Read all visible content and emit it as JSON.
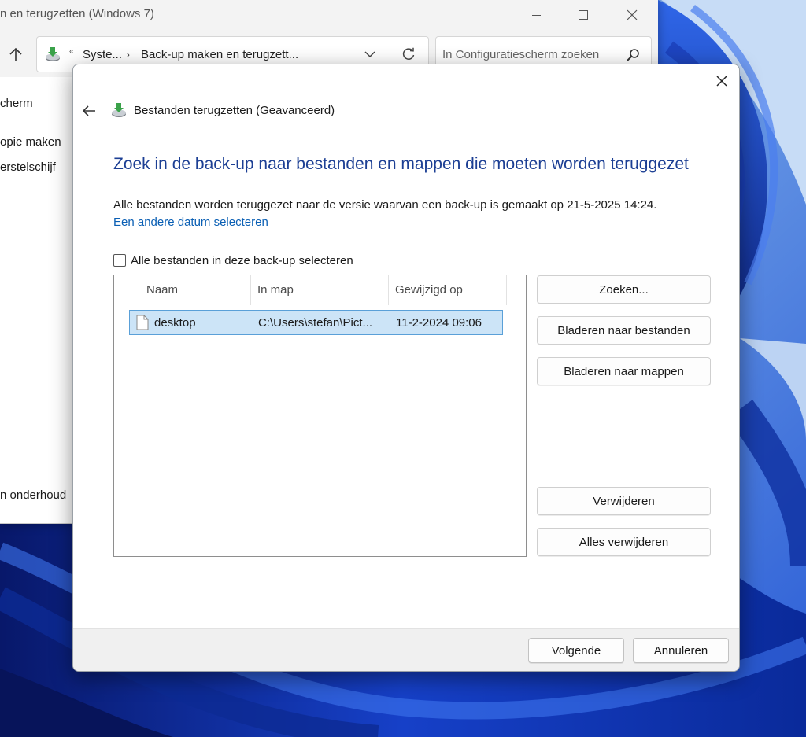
{
  "background_window": {
    "title": "n en terugzetten (Windows 7)",
    "address": {
      "overflow": "«",
      "crumb1": "Syste...",
      "separator": "›",
      "crumb2": "Back-up maken en terugzett..."
    },
    "search_placeholder": "In Configuratiescherm zoeken",
    "side_links": [
      "cherm",
      "opie maken",
      "erstelschijf",
      "n onderhoud"
    ]
  },
  "dialog": {
    "title": "Bestanden terugzetten (Geavanceerd)",
    "heading": "Zoek in de back-up naar bestanden en mappen die moeten worden teruggezet",
    "info": "Alle bestanden worden teruggezet naar de versie waarvan een back-up is gemaakt op 21-5-2025 14:24.",
    "date_link": "Een andere datum selecteren",
    "select_all_label": "Alle bestanden in deze back-up selecteren",
    "select_all_checked": false,
    "columns": [
      "Naam",
      "In map",
      "Gewijzigd op"
    ],
    "files": [
      {
        "name": "desktop",
        "folder": "C:\\Users\\stefan\\Pict...",
        "modified": "11-2-2024 09:06",
        "selected": true
      }
    ],
    "buttons": {
      "search": "Zoeken...",
      "browse_files": "Bladeren naar bestanden",
      "browse_folders": "Bladeren naar mappen",
      "remove": "Verwijderen",
      "remove_all": "Alles verwijderen",
      "next": "Volgende",
      "cancel": "Annuleren"
    }
  },
  "colors": {
    "heading": "#1c3f94",
    "link": "#0a5fb4",
    "selection": "#cce4f7",
    "wallpaper_dark": "#0a1f78",
    "wallpaper_light": "#9cc0f0"
  }
}
